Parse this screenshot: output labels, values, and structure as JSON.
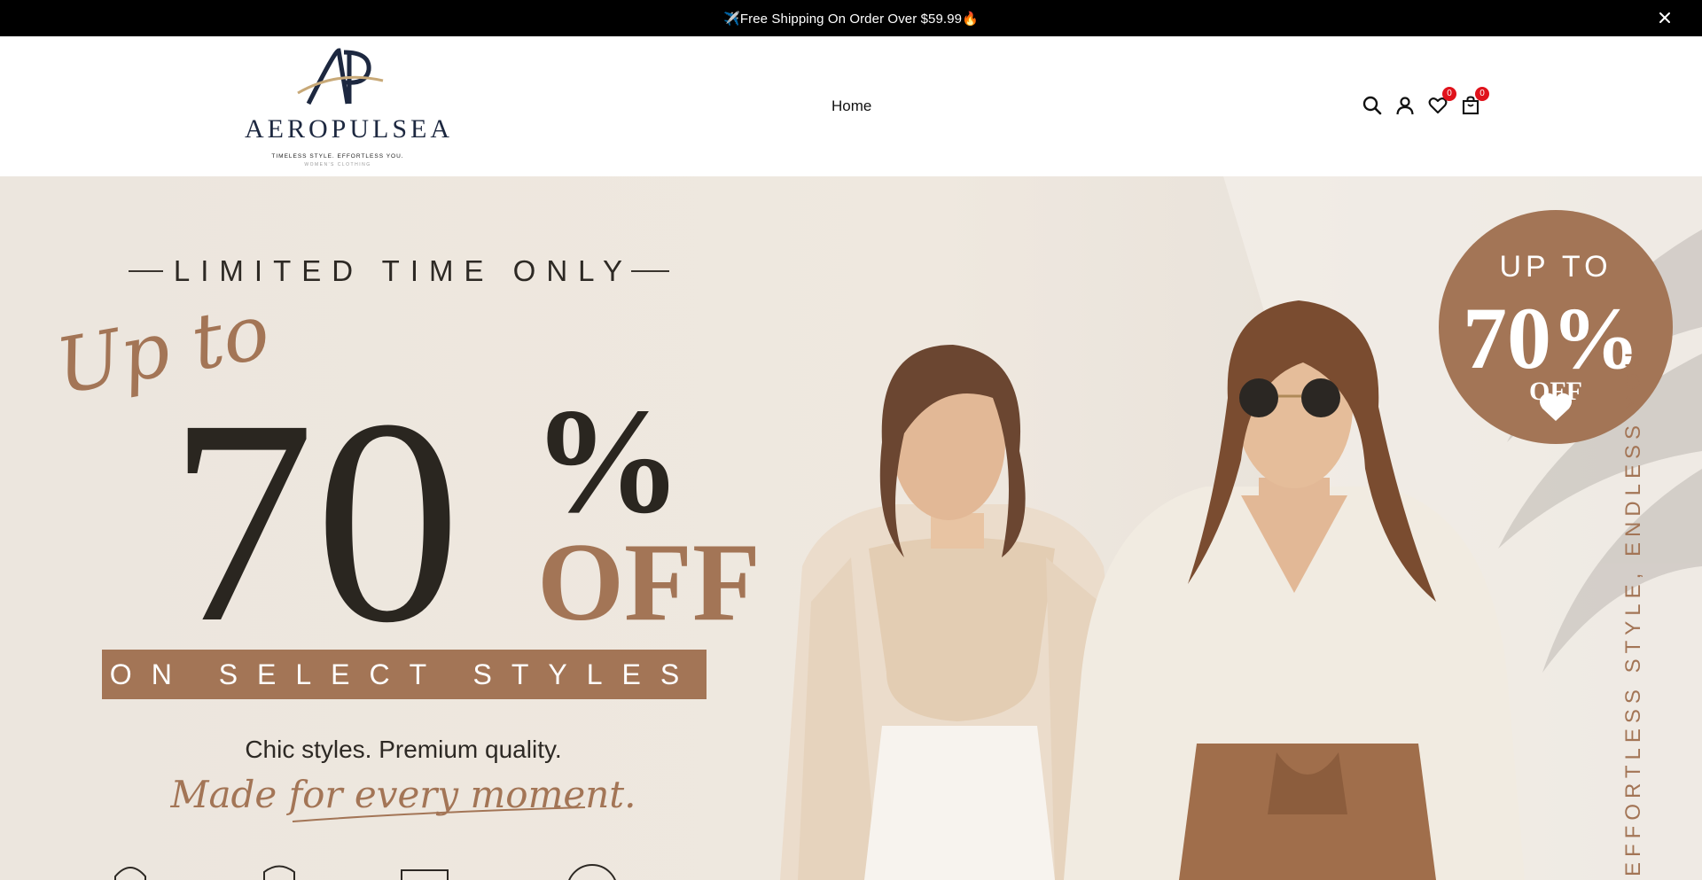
{
  "announcement": {
    "text": "✈️Free Shipping On Order Over $59.99🔥",
    "close_icon": "close-icon"
  },
  "brand": {
    "name": "AEROPULSEA",
    "monogram": "AP",
    "tagline": "TIMELESS STYLE. EFFORTLESS YOU.",
    "subline": "WOMEN'S CLOTHING"
  },
  "nav": {
    "items": [
      {
        "label": "Home"
      }
    ]
  },
  "header_icons": {
    "search": "search-icon",
    "account": "user-icon",
    "wishlist": {
      "icon": "heart-icon",
      "count": "0"
    },
    "cart": {
      "icon": "bag-icon",
      "count": "0"
    }
  },
  "hero": {
    "kicker": "LIMITED TIME ONLY",
    "script_prefix": "Up to",
    "big_number": "70",
    "percent": "%",
    "off": "OFF",
    "band": "ON SELECT STYLES",
    "line1": "Chic styles. Premium quality.",
    "line2": "Made for every moment.",
    "badge": {
      "top": "UP TO",
      "value": "70%",
      "off": "OFF"
    },
    "vertical": "EFFORTLESS STYLE, ENDLESS YOU.",
    "colors": {
      "accent": "#a37556",
      "dark": "#2a2620",
      "bg": "#ede7df"
    }
  }
}
